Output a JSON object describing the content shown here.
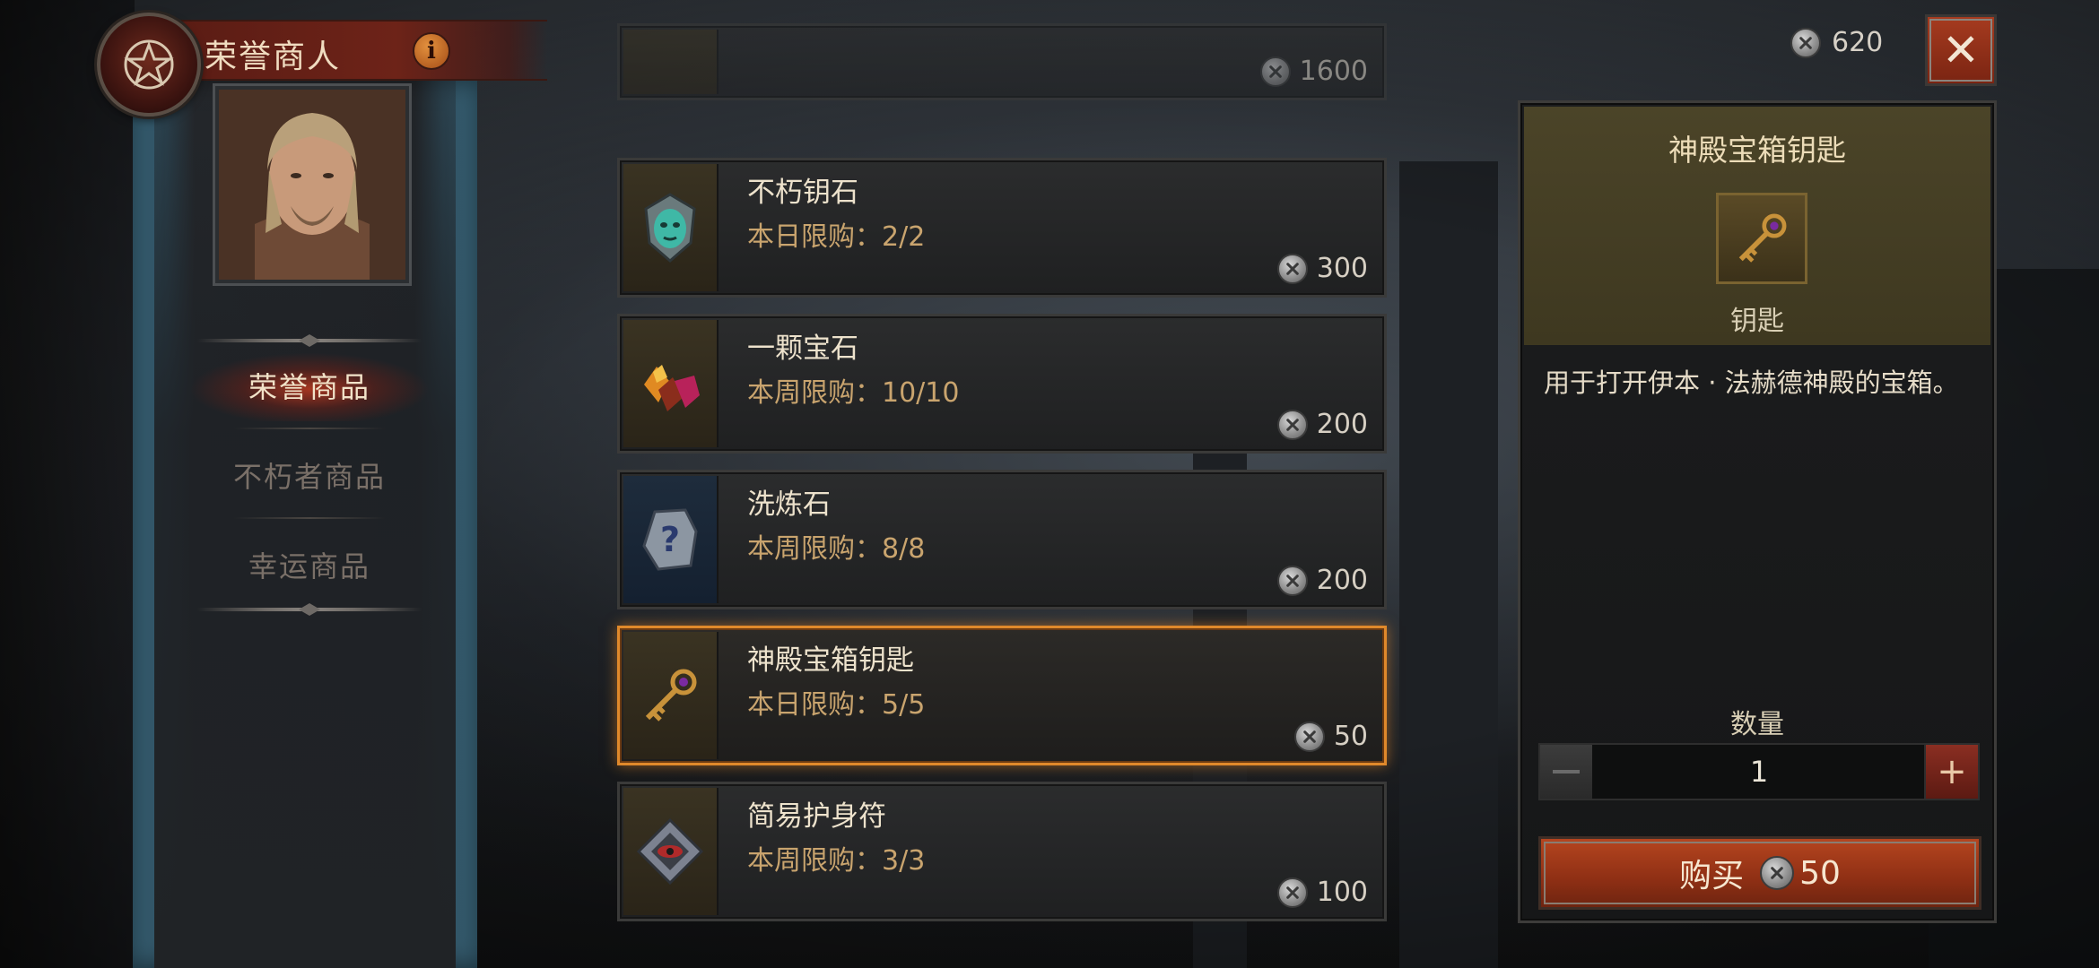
{
  "header": {
    "title": "荣誉商人",
    "info_label": "i"
  },
  "currency": {
    "amount": "620"
  },
  "close_label": "✕",
  "sidebar": {
    "tabs": [
      {
        "label": "荣誉商品",
        "active": true
      },
      {
        "label": "不朽者商品",
        "active": false
      },
      {
        "label": "幸运商品",
        "active": false
      }
    ]
  },
  "items": [
    {
      "name": "",
      "limit": "",
      "price": "1600",
      "icon": "unknown-item-icon"
    },
    {
      "name": "不朽钥石",
      "limit": "本日限购：2/2",
      "price": "300",
      "icon": "keystone-icon"
    },
    {
      "name": "一颗宝石",
      "limit": "本周限购：10/10",
      "price": "200",
      "icon": "gems-icon"
    },
    {
      "name": "洗炼石",
      "limit": "本周限购：8/8",
      "price": "200",
      "icon": "mystery-stone-icon"
    },
    {
      "name": "神殿宝箱钥匙",
      "limit": "本日限购：5/5",
      "price": "50",
      "icon": "key-icon"
    },
    {
      "name": "简易护身符",
      "limit": "本周限购：3/3",
      "price": "100",
      "icon": "charm-icon"
    }
  ],
  "detail": {
    "title": "神殿宝箱钥匙",
    "type": "钥匙",
    "description": "用于打开伊本 · 法赫德神殿的宝箱。",
    "quantity_label": "数量",
    "quantity": "1",
    "buy_label": "购买",
    "buy_price": "50"
  },
  "colors": {
    "accent": "#e0892b",
    "buy_button": "#b5451f",
    "limit_text": "#c9a46e"
  }
}
